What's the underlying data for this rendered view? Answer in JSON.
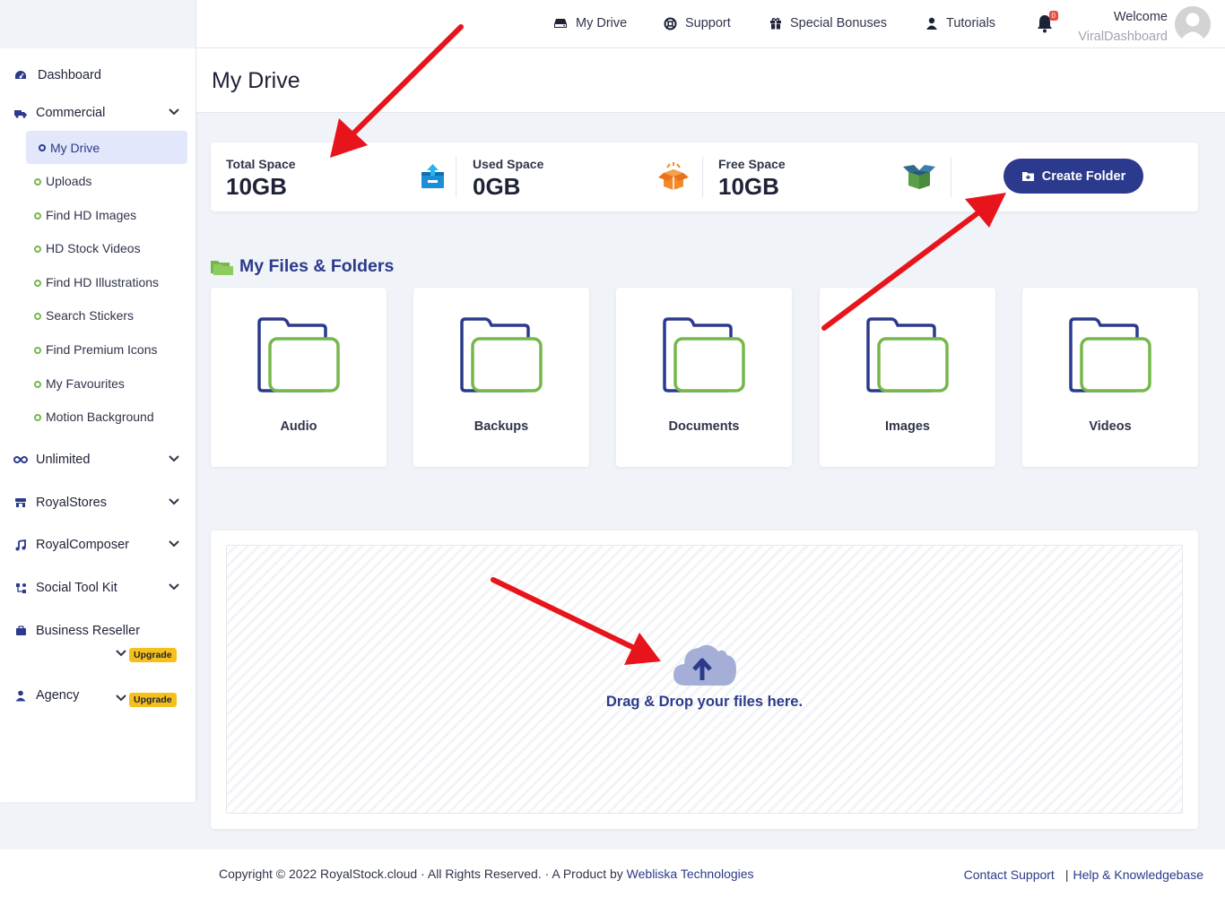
{
  "header": {
    "nav": [
      {
        "label": "My Drive",
        "icon": "drive-icon"
      },
      {
        "label": "Support",
        "icon": "support-icon"
      },
      {
        "label": "Special Bonuses",
        "icon": "gift-icon"
      },
      {
        "label": "Tutorials",
        "icon": "user-icon"
      }
    ],
    "notification_count": "0",
    "welcome": "Welcome",
    "username": "ViralDashboard"
  },
  "sidebar": {
    "dashboard": "Dashboard",
    "commercial": "Commercial",
    "commercial_items": [
      "My Drive",
      "Uploads",
      "Find HD Images",
      "HD Stock Videos",
      "Find HD Illustrations",
      "Search Stickers",
      "Find Premium Icons",
      "My Favourites",
      "Motion Background"
    ],
    "unlimited": "Unlimited",
    "royalstores": "RoyalStores",
    "royalcomposer": "RoyalComposer",
    "socialtoolkit": "Social Tool Kit",
    "business_reseller": "Business Reseller",
    "agency": "Agency",
    "upgrade": "Upgrade"
  },
  "page": {
    "title": "My Drive"
  },
  "stats": {
    "total_label": "Total Space",
    "total_value": "10GB",
    "used_label": "Used Space",
    "used_value": "0GB",
    "free_label": "Free Space",
    "free_value": "10GB",
    "create_folder": "Create Folder"
  },
  "files": {
    "section_title": "My Files & Folders",
    "folders": [
      "Audio",
      "Backups",
      "Documents",
      "Images",
      "Videos"
    ]
  },
  "dropzone": {
    "text": "Drag & Drop your files here."
  },
  "footer": {
    "copyright": "Copyright © 2022 RoyalStock.cloud · All Rights Reserved. · A Product by ",
    "company": "Webliska Technologies",
    "contact": "Contact Support",
    "sep": "|",
    "help": "Help & Knowledgebase"
  },
  "colors": {
    "primary": "#2b3a8c",
    "accent_green": "#76b74b",
    "annotation_red": "#e8141b",
    "upgrade_yellow": "#f6c01c"
  }
}
